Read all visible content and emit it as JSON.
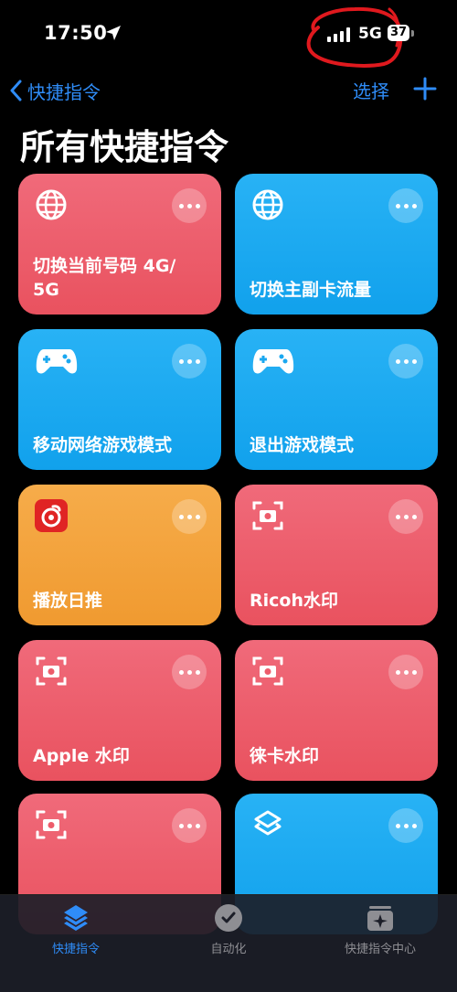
{
  "status_bar": {
    "time": "17:50",
    "network": "5G",
    "battery": "37"
  },
  "nav": {
    "back_label": "快捷指令",
    "select_label": "选择"
  },
  "page_title": "所有快捷指令",
  "cards": [
    {
      "label": "切换当前号码 4G/\n5G",
      "icon": "globe-icon",
      "color": "#ed5c6b"
    },
    {
      "label": "切换主副卡流量",
      "icon": "globe-icon",
      "color": "#1ba8f0"
    },
    {
      "label": "移动网络游戏模式",
      "icon": "gamepad-icon",
      "color": "#1ba8f0"
    },
    {
      "label": "退出游戏模式",
      "icon": "gamepad-icon",
      "color": "#1ba8f0"
    },
    {
      "label": "播放日推",
      "icon": "netease-music-icon",
      "color": "#f3a23b"
    },
    {
      "label": "Ricoh水印",
      "icon": "camera-scan-icon",
      "color": "#ed5c6b"
    },
    {
      "label": "Apple 水印",
      "icon": "camera-scan-icon",
      "color": "#ed5c6b"
    },
    {
      "label": "徕卡水印",
      "icon": "camera-scan-icon",
      "color": "#ed5c6b"
    },
    {
      "label": "",
      "icon": "camera-scan-icon",
      "color": "#ed5c6b"
    },
    {
      "label": "",
      "icon": "shortcuts-layers-icon",
      "color": "#1ba8f0"
    }
  ],
  "tabs": [
    {
      "label": "快捷指令",
      "active": true
    },
    {
      "label": "自动化",
      "active": false
    },
    {
      "label": "快捷指令中心",
      "active": false
    }
  ],
  "colors": {
    "accent": "#2f8cf7",
    "card_red": "#ed5c6b",
    "card_blue": "#1ba8f0",
    "card_orange": "#f3a23b"
  }
}
